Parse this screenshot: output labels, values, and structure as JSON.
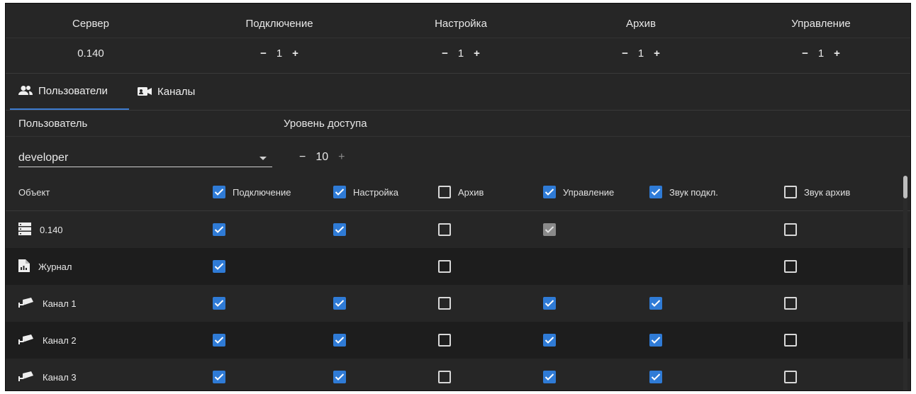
{
  "top_grid": {
    "headers": [
      "Сервер",
      "Подключение",
      "Настройка",
      "Архив",
      "Управление"
    ],
    "server_value": "0.140",
    "levels": [
      {
        "minus": "−",
        "value": "1",
        "plus": "+"
      },
      {
        "minus": "−",
        "value": "1",
        "plus": "+"
      },
      {
        "minus": "−",
        "value": "1",
        "plus": "+"
      },
      {
        "minus": "−",
        "value": "1",
        "plus": "+"
      }
    ]
  },
  "tabs": [
    {
      "label": "Пользователи",
      "icon": "users-icon",
      "active": true
    },
    {
      "label": "Каналы",
      "icon": "video-camera-icon",
      "active": false
    }
  ],
  "user_section": {
    "user_label": "Пользователь",
    "access_label": "Уровень доступа",
    "selected_user": "developer",
    "access_minus": "−",
    "access_value": "10",
    "access_plus": "+"
  },
  "table": {
    "object_header": "Объект",
    "columns": [
      {
        "label": "Подключение",
        "checked": true
      },
      {
        "label": "Настройка",
        "checked": true
      },
      {
        "label": "Архив",
        "checked": false
      },
      {
        "label": "Управление",
        "checked": true
      },
      {
        "label": "Звук подкл.",
        "checked": true
      },
      {
        "label": "Звук архив",
        "checked": false
      }
    ],
    "rows": [
      {
        "name": "0.140",
        "icon": "server-icon",
        "cells": [
          "on",
          "on",
          "off",
          "dis",
          null,
          "off"
        ]
      },
      {
        "name": "Журнал",
        "icon": "report-file-icon",
        "cells": [
          "on",
          null,
          "off",
          null,
          null,
          "off"
        ]
      },
      {
        "name": "Канал 1",
        "icon": "security-camera-icon",
        "cells": [
          "on",
          "on",
          "off",
          "on",
          "on",
          "off"
        ]
      },
      {
        "name": "Канал 2",
        "icon": "security-camera-icon",
        "cells": [
          "on",
          "on",
          "off",
          "on",
          "on",
          "off"
        ]
      },
      {
        "name": "Канал 3",
        "icon": "security-camera-icon",
        "cells": [
          "on",
          "on",
          "off",
          "on",
          "on",
          "off"
        ]
      }
    ]
  },
  "colors": {
    "background": "#262626",
    "row_alt": "#1d1d1d",
    "accent": "#2f7bd6",
    "tab_underline": "#3d7bd0",
    "text": "#e8e8e8"
  }
}
